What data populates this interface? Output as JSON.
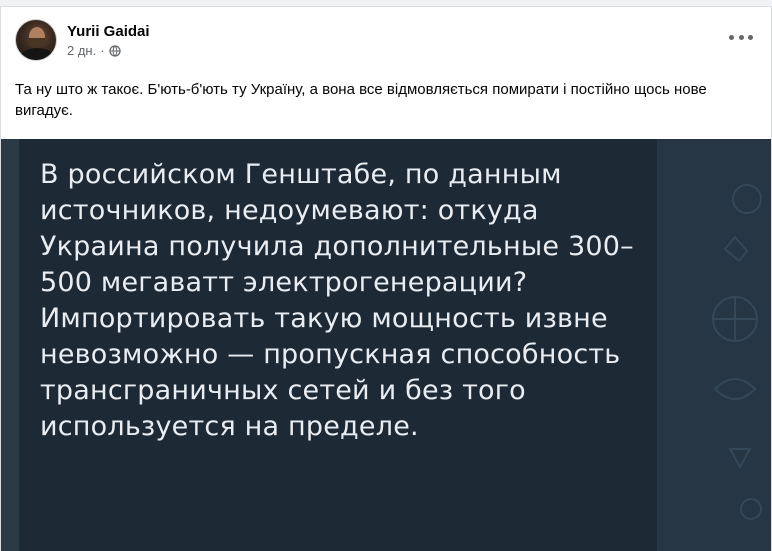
{
  "post": {
    "author": "Yurii Gaidai",
    "time": "2 дн.",
    "separator": "·",
    "text": "Та ну што ж такоє. Б'ють-б'ють ту Україну, а вона все відмовляється помирати і постійно щось нове вигадує.",
    "more_icon": "more-horizontal-icon",
    "audience_icon": "globe-icon"
  },
  "image": {
    "text": "В российском Генштабе, по данным источников, недоумевают: откуда Украина получила дополнительные 300–500 мегаватт электрогенерации? Импортировать такую мощность извне невозможно — пропускная способность трансграничных сетей и без того используется на пределе."
  },
  "colors": {
    "author": "#050505",
    "secondary": "#65676b",
    "card_bg": "#1d2a36",
    "card_text": "#e9edf1"
  }
}
